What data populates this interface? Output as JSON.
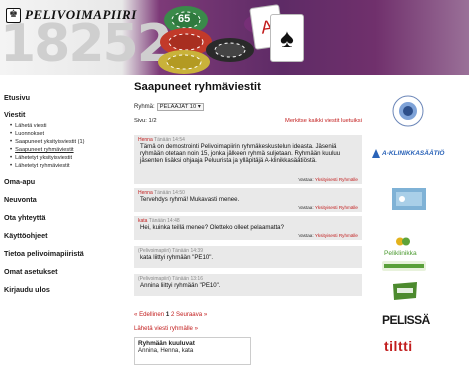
{
  "header": {
    "brand": "PELIVOIMAPIIRI",
    "banner_number": "18252",
    "chip_label": "65"
  },
  "sidebar": {
    "sections": [
      {
        "label": "Etusivu"
      },
      {
        "label": "Viestit",
        "items": [
          {
            "label": "Lähetä viesti"
          },
          {
            "label": "Luonnokset"
          },
          {
            "label": "Saapuneet yksityisviestit (1)"
          },
          {
            "label": "Saapuneet ryhmäviestit",
            "current": true
          },
          {
            "label": "Lähetetyt yksityisviestit"
          },
          {
            "label": "Lähetetyt ryhmäviestit"
          }
        ]
      },
      {
        "label": "Oma-apu"
      },
      {
        "label": "Neuvonta"
      },
      {
        "label": "Ota yhteyttä"
      },
      {
        "label": "Käyttöohjeet"
      },
      {
        "label": "Tietoa pelivoimapiiristä"
      },
      {
        "label": "Omat asetukset"
      },
      {
        "label": "Kirjaudu ulos"
      }
    ]
  },
  "main": {
    "title": "Saapuneet ryhmäviestit",
    "group_label": "Ryhmä:",
    "group_value": "PELAAJAT 10",
    "page_label": "Sivu: 1/2",
    "mark_all_read": "Merkitse kaikki viestit luetuiksi",
    "reply_label": "Vastaa:",
    "reply_private": "Yksityisesti",
    "reply_group": "Ryhmälle",
    "messages": [
      {
        "author": "Henna",
        "time": "Tänään 14:54",
        "body": "Tämä on demostrointi Pelivoimapiirin ryhmäkeskustelun ideasta. Jäseniä ryhmään otetaan noin 15, jonka jälkeen ryhmä suljetaan. Ryhmään kuuluu jäsenten lisäksi ohjaaja Peluurista ja ylläpitäjä A-klinikkasäätiöstä."
      },
      {
        "author": "Henna",
        "time": "Tänään 14:50",
        "body": "Tervehdys ryhmä! Mukavasti menee."
      },
      {
        "author": "kata",
        "time": "Tänään 14:48",
        "body": "Hei, kuinka teillä menee? Oletteko olleet pelaamatta?"
      },
      {
        "author": "(Pelivoimapiiri)",
        "time": "Tänään 14:39",
        "body": "kata liittyi ryhmään \"PE10\"."
      },
      {
        "author": "(Pelivoimapiiri)",
        "time": "Tänään 13:16",
        "body": "Annina liittyi ryhmään \"PE10\"."
      }
    ],
    "pager": {
      "prev": "« Edellinen",
      "page1": "1",
      "page2": "2",
      "next": "Seuraava »"
    },
    "send_group_message": "Lähetä viesti ryhmälle »",
    "members_title": "Ryhmään kuuluvat",
    "members_list": "Annina, Henna, kata"
  },
  "partners": {
    "a_klinikka": "A-KLINIKKASÄÄTIÖ",
    "peliklinikka": "Peliklinikka",
    "pelissa": "PELISSÄ",
    "tiltti": "tiltti"
  },
  "colors": {
    "accent_red": "#c21d1d",
    "banner_purple": "#5e2b66",
    "message_bg": "#e9e9e9"
  }
}
